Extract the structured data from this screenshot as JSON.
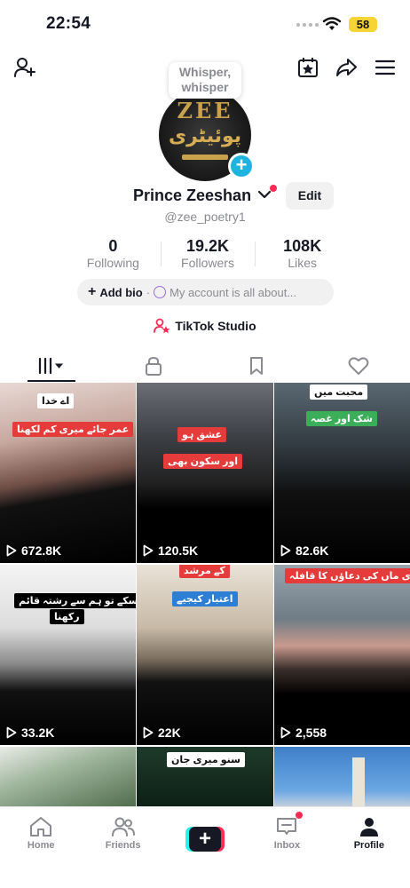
{
  "status_bar": {
    "time": "22:54",
    "battery": "58"
  },
  "avatar": {
    "bubble": "Whisper, whisper",
    "logo_top": "ZEE",
    "logo_urdu": "پوئیٹری"
  },
  "profile": {
    "name": "Prince Zeeshan",
    "handle": "@zee_poetry1",
    "edit_label": "Edit",
    "stats": [
      {
        "value": "0",
        "label": "Following"
      },
      {
        "value": "19.2K",
        "label": "Followers"
      },
      {
        "value": "108K",
        "label": "Likes"
      }
    ],
    "bio_add": "Add bio",
    "bio_hint": "My account is all about...",
    "studio": "TikTok Studio"
  },
  "videos": [
    {
      "views": "672.8K",
      "tags": [
        "اے خدا",
        "عمر جائے میری کم لکھنا"
      ]
    },
    {
      "views": "120.5K",
      "tags": [
        "عشق ہو",
        "اور سکون بھی"
      ]
    },
    {
      "views": "82.6K",
      "tags": [
        "محبت میں",
        "شک اور غصہ"
      ]
    },
    {
      "views": "33.2K",
      "tags": [
        "ہوسکے تو ہم سے رشتہ قائم",
        "رکھنا"
      ]
    },
    {
      "views": "22K",
      "tags": [
        "کے مرشد",
        "اعتبار کیجیے"
      ]
    },
    {
      "views": "2,558",
      "tags": [
        "میری ماں کی دعاؤں کا قافلہ"
      ]
    },
    {
      "views": "",
      "tags": []
    },
    {
      "views": "",
      "tags": [
        "سنو میری جان"
      ]
    },
    {
      "views": "",
      "tags": []
    }
  ],
  "nav": {
    "home": "Home",
    "friends": "Friends",
    "inbox": "Inbox",
    "profile": "Profile"
  }
}
